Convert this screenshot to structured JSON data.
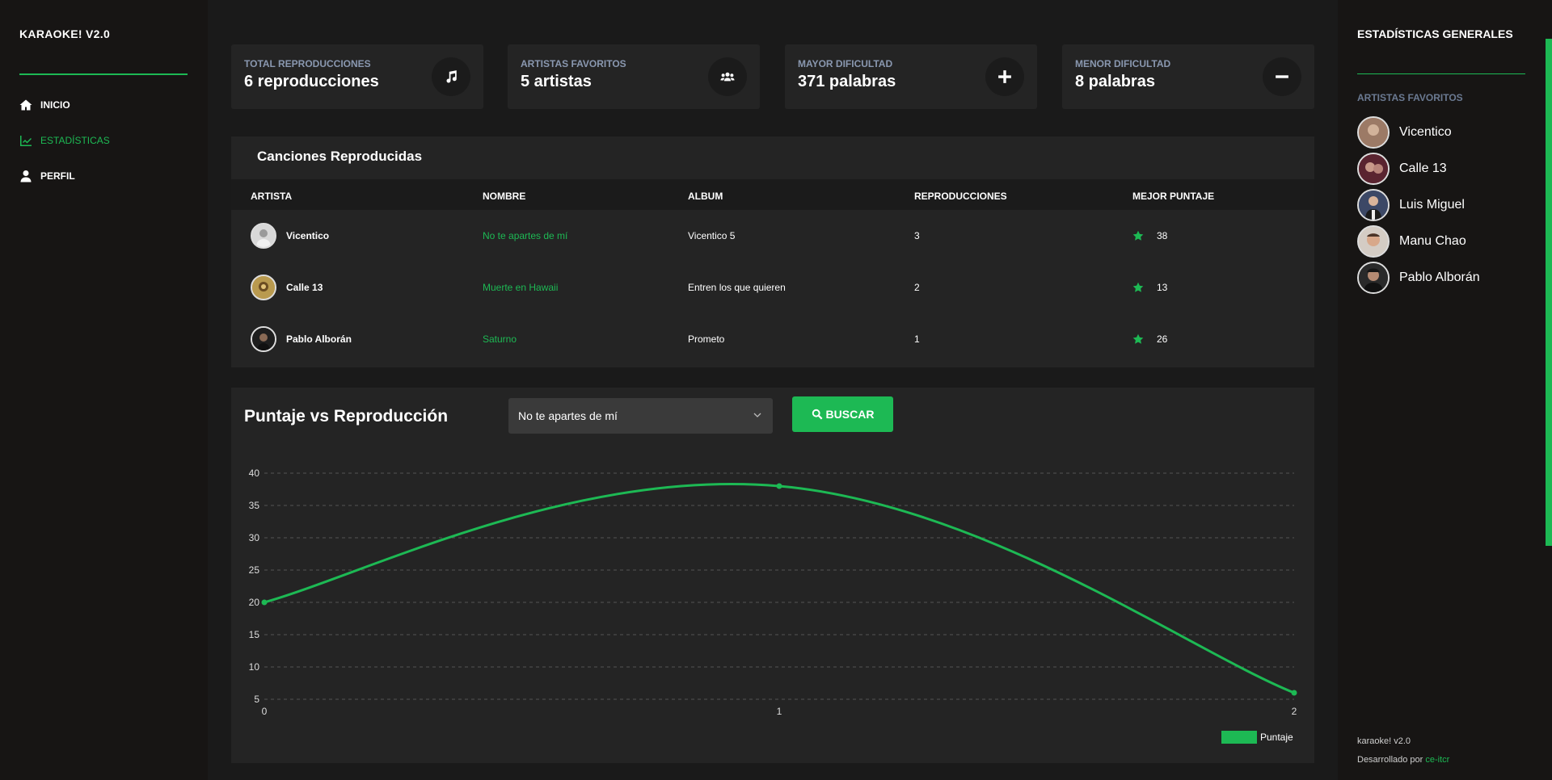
{
  "sidebar": {
    "brand": "KARAOKE! V2.0",
    "items": [
      {
        "label": "INICIO",
        "icon": "home-icon",
        "active": false
      },
      {
        "label": "ESTADÍSTICAS",
        "icon": "chart-icon",
        "active": true
      },
      {
        "label": "PERFIL",
        "icon": "user-icon",
        "active": false
      }
    ]
  },
  "stats": [
    {
      "label": "TOTAL REPRODUCCIONES",
      "value": "6 reproducciones",
      "icon": "music-icon"
    },
    {
      "label": "ARTISTAS FAVORITOS",
      "value": "5 artistas",
      "icon": "users-icon"
    },
    {
      "label": "MAYOR DIFICULTAD",
      "value": "371 palabras",
      "icon": "plus-icon"
    },
    {
      "label": "MENOR DIFICULTAD",
      "value": "8 palabras",
      "icon": "minus-icon"
    }
  ],
  "songs_table": {
    "title": "Canciones Reproducidas",
    "headers": [
      "ARTISTA",
      "NOMBRE",
      "ALBUM",
      "REPRODUCCIONES",
      "MEJOR PUNTAJE"
    ],
    "rows": [
      {
        "artist": "Vicentico",
        "song": "No te apartes de mí",
        "album": "Vicentico 5",
        "plays": "3",
        "score": "38"
      },
      {
        "artist": "Calle 13",
        "song": "Muerte en Hawaii",
        "album": "Entren los que quieren",
        "plays": "2",
        "score": "13"
      },
      {
        "artist": "Pablo Alborán",
        "song": "Saturno",
        "album": "Prometo",
        "plays": "1",
        "score": "26"
      }
    ]
  },
  "chart_panel": {
    "title": "Puntaje vs Reproducción",
    "select_value": "No te apartes de mí",
    "search_label": "BUSCAR"
  },
  "chart_data": {
    "type": "line",
    "x": [
      0,
      1,
      2
    ],
    "series": [
      {
        "name": "Puntaje",
        "values": [
          20,
          38,
          6
        ]
      }
    ],
    "xlabel": "",
    "ylabel": "",
    "ylim": [
      5,
      40
    ],
    "yticks": [
      5,
      10,
      15,
      20,
      25,
      30,
      35,
      40
    ],
    "xticks": [
      0,
      1,
      2
    ],
    "grid": true,
    "legend": "bottom-right",
    "color": "#1db954"
  },
  "right_panel": {
    "title": "ESTADÍSTICAS GENERALES",
    "subtitle": "ARTISTAS FAVORITOS",
    "favorites": [
      "Vicentico",
      "Calle 13",
      "Luis Miguel",
      "Manu Chao",
      "Pablo Alborán"
    ],
    "footer_line1": "karaoke! v2.0",
    "footer_prefix": "Desarrollado por",
    "footer_link": "ce-itcr"
  },
  "colors": {
    "accent": "#1db954",
    "background": "#1a1a1a",
    "panel": "#242424",
    "sidebar": "#171514"
  }
}
